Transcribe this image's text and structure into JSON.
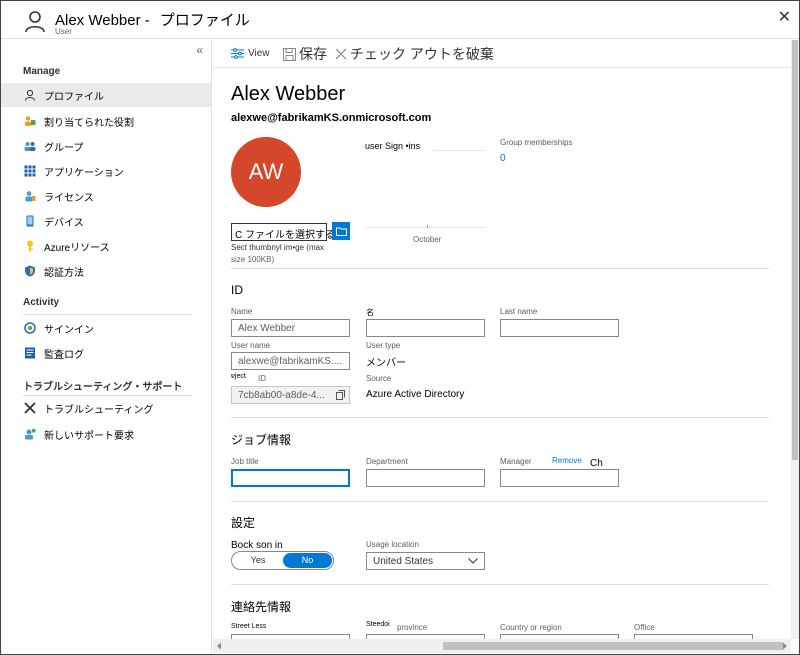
{
  "window": {
    "title": "Alex Webber -",
    "title2": "プロファイル",
    "subtitle": "User",
    "close": "✕"
  },
  "sidebar": {
    "collapse": "«",
    "sections": [
      {
        "title": "Manage"
      },
      {
        "title": "Activity"
      },
      {
        "title": "トラブルシューティング・サポート"
      }
    ],
    "items": [
      {
        "label": "プロファイル",
        "icon": "person-icon"
      },
      {
        "label": "割り当てられた役割",
        "icon": "roles-icon"
      },
      {
        "label": "グループ",
        "icon": "groups-icon"
      },
      {
        "label": "アプリケーション",
        "icon": "apps-icon"
      },
      {
        "label": "ライセンス",
        "icon": "license-icon"
      },
      {
        "label": "デバイス",
        "icon": "device-icon"
      },
      {
        "label": "Azureリソース",
        "icon": "key-icon"
      },
      {
        "label": "認証方法",
        "icon": "shield-icon"
      },
      {
        "label": "サインイン",
        "icon": "signin-icon"
      },
      {
        "label": "監査ログ",
        "icon": "audit-icon"
      },
      {
        "label": "トラブルシューティング",
        "icon": "tools-icon"
      },
      {
        "label": "新しいサポート要求",
        "icon": "support-icon"
      }
    ]
  },
  "toolbar": {
    "view": "View",
    "save": "保存",
    "discard": "チェック アウトを破棄"
  },
  "profile": {
    "name": "Alex Webber",
    "email": "alexwe@fabrikamKS.onmicrosoft.com",
    "initials": "AW",
    "avatar_color": "#d4472a",
    "signins_label": "user Sign •ins",
    "chart_axis": "October",
    "group_label": "Group memberships",
    "group_count": "0",
    "choose_file": "C ファイルを選択する",
    "thumb_hint1": "Sect thumbnyl im•ge (max",
    "thumb_hint2": "size 100KB)"
  },
  "identity": {
    "heading": "ID",
    "name_label": "Name",
    "name_value": "Alex Webber",
    "first_label": "名",
    "last_label": "Last name",
    "username_label": "User name",
    "username_value": "alexwe@fabrikamKS....",
    "usertype_label": "User type",
    "usertype_value": "メンバー",
    "object_label": "ɐject",
    "id_label": "ID",
    "object_value": "7cb8ab00-a8de-4...",
    "source_label": "Source",
    "source_value": "Azure Active Directory"
  },
  "job": {
    "heading": "ジョブ情報",
    "title_label": "Job title",
    "dept_label": "Department",
    "manager_label": "Manager",
    "remove": "Remove",
    "change": "Ch"
  },
  "settings": {
    "heading": "設定",
    "block_label": "Bock son in",
    "yes": "Yes",
    "no": "No",
    "usage_label": "Usage location",
    "usage_value": "United States"
  },
  "contact": {
    "heading": "連絡先情報",
    "street_label": "Street Less",
    "state_label_a": "Steedoi",
    "state_label_b": "province",
    "country_label": "Country or region",
    "office_label": "Office"
  },
  "colors": {
    "accent": "#0078d4",
    "avatar": "#d4472a"
  }
}
